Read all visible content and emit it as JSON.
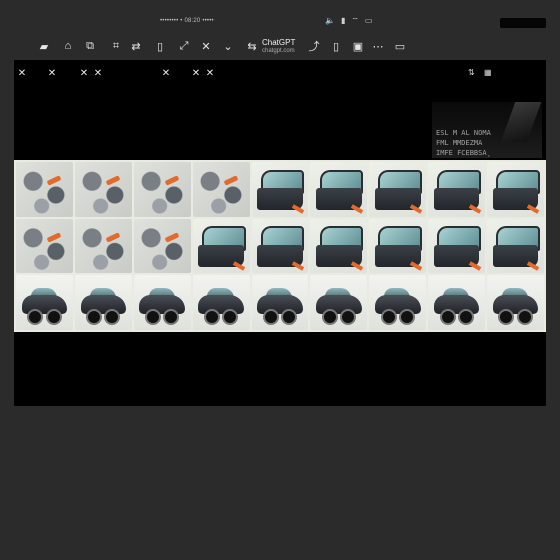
{
  "status": {
    "text": "•••••••• • 08:20 •••••"
  },
  "toolbar": {
    "brand_title": "ChatGPT",
    "brand_url": "chatgpt.com"
  },
  "icons": {
    "status": [
      "volume-icon",
      "signal-icon",
      "wifi-icon",
      "battery-icon"
    ],
    "toolbar": [
      "photo-icon",
      "lock-icon",
      "copy-icon",
      "crop-icon",
      "shuffle-icon",
      "phone-icon",
      "expand-icon",
      "close-icon",
      "chevron-down-icon",
      "swap-icon",
      "share-icon",
      "bookmark-icon",
      "image-icon",
      "more-icon"
    ]
  },
  "viewer": {
    "dark_image_text": "ESL M AL NOMA\nFML MMDEZMA\nIMFE FCEBBSA¸",
    "grid_tiles": [
      "parts",
      "parts",
      "parts",
      "parts",
      "door",
      "door",
      "door",
      "door",
      "door",
      "parts",
      "parts",
      "parts",
      "door",
      "door",
      "door",
      "door",
      "door",
      "door",
      "car",
      "car",
      "car",
      "car",
      "car",
      "car",
      "car",
      "car",
      "car"
    ]
  }
}
